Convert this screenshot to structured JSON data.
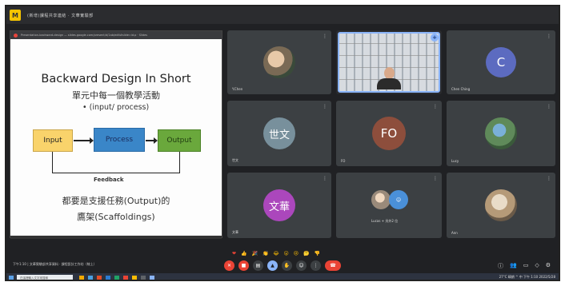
{
  "window": {
    "app_logo": "M",
    "title": "(新增)課程共享連結 · 文華實驗部"
  },
  "slide": {
    "tab_url": "Presentation-backward-design — slides.google.com/present/d/1ab/edit#slide=id.p · Slides",
    "title": "Backward Design In Short",
    "subtitle": "單元中每一個教學活動",
    "bullet": "• (input/ process)",
    "input_label": "Input",
    "process_label": "Process",
    "output_label": "Output",
    "feedback_label": "Feedback",
    "line1": "都要是支援任務(Output)的",
    "line2": "鷹架(Scaffoldings)"
  },
  "participants": [
    {
      "name": "Y.Chen",
      "kind": "photo"
    },
    {
      "name": "",
      "kind": "speaker"
    },
    {
      "name": "Chen Ching",
      "initial": "C",
      "color": "#5c6bc0"
    },
    {
      "name": "世文",
      "initial": "世文",
      "color": "#78909c"
    },
    {
      "name": "FO",
      "initial": "FO",
      "color": "#8d4e3c"
    },
    {
      "name": "Lucy",
      "kind": "photo"
    },
    {
      "name": "文華",
      "initial": "文華",
      "color": "#ab47bc"
    },
    {
      "name": "Lucas + 另外2 位",
      "kind": "group"
    },
    {
      "name": "Ann",
      "kind": "photo"
    }
  ],
  "bottombar": {
    "meeting_info": "下午1:10 | 文華實驗部共享資料 · 課程設計工作坊（線上）",
    "reactions": [
      "❤",
      "👍",
      "🎉",
      "👏",
      "😂",
      "😮",
      "😢",
      "🤔",
      "👎"
    ],
    "controls": [
      "mic-off",
      "video-off",
      "present",
      "raise-hand",
      "emoji",
      "more",
      "end-call"
    ]
  },
  "taskbar": {
    "search_placeholder": "在這裡輸入文字來搜尋",
    "tray_text": "27°C 晴朗 ^ 中 下午 1:10 2022/5/28"
  },
  "colors": {
    "accent": "#8ab4f8",
    "end_call": "#ea4335",
    "input_box": "#f9d36b",
    "process_box": "#3a86c8",
    "output_box": "#6aa83c"
  }
}
